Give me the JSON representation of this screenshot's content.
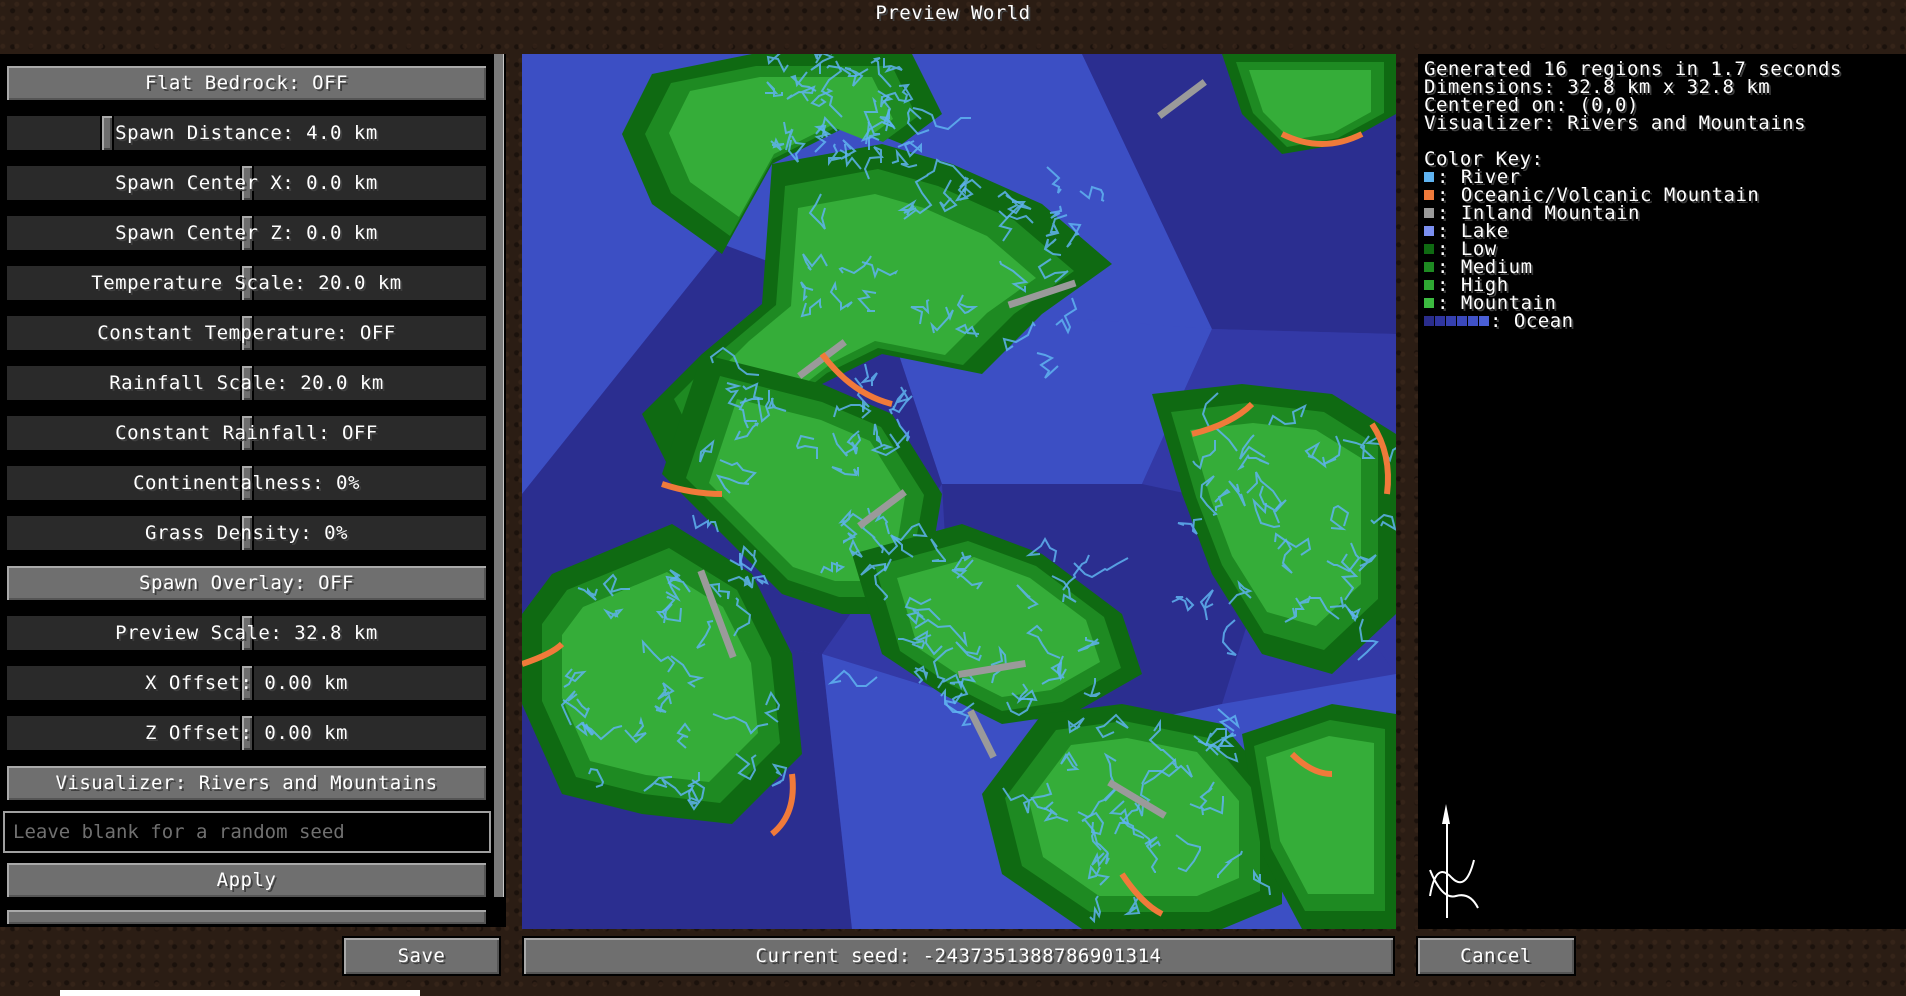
{
  "title": "Preview World",
  "settings": [
    {
      "kind": "button",
      "label": "Flat Bedrock: OFF"
    },
    {
      "kind": "slider",
      "label": "Spawn Distance: 4.0 km",
      "value": 0.2
    },
    {
      "kind": "slider",
      "label": "Spawn Center X: 0.0 km",
      "value": 0.5
    },
    {
      "kind": "slider",
      "label": "Spawn Center Z: 0.0 km",
      "value": 0.5
    },
    {
      "kind": "slider",
      "label": "Temperature Scale: 20.0 km",
      "value": 0.5
    },
    {
      "kind": "slider",
      "label": "Constant Temperature: OFF",
      "value": 0.5
    },
    {
      "kind": "slider",
      "label": "Rainfall Scale: 20.0 km",
      "value": 0.5
    },
    {
      "kind": "slider",
      "label": "Constant Rainfall: OFF",
      "value": 0.5
    },
    {
      "kind": "slider",
      "label": "Continentalness: 0%",
      "value": 0.5
    },
    {
      "kind": "slider",
      "label": "Grass Density: 0%",
      "value": 0.5
    },
    {
      "kind": "button",
      "label": "Spawn Overlay: OFF"
    },
    {
      "kind": "slider",
      "label": "Preview Scale: 32.8 km",
      "value": 0.5
    },
    {
      "kind": "slider",
      "label": "X Offset: 0.00 km",
      "value": 0.5
    },
    {
      "kind": "slider",
      "label": "Z Offset: 0.00 km",
      "value": 0.5
    },
    {
      "kind": "button",
      "label": "Visualizer: Rivers and Mountains"
    }
  ],
  "seed_input": {
    "placeholder": "Leave blank for a random seed",
    "value": ""
  },
  "apply_label": "Apply",
  "save_label": "Save",
  "current_seed": "Current seed: -2437351388786901314",
  "cancel_label": "Cancel",
  "info": {
    "lines": [
      "Generated 16 regions in 1.7 seconds",
      "Dimensions: 32.8 km x 32.8 km",
      "Centered on: (0,0)",
      "Visualizer: Rivers and Mountains"
    ],
    "color_key_title": "Color Key:",
    "key": [
      {
        "label": ": River",
        "color": "#5fb3f0"
      },
      {
        "label": ": Oceanic/Volcanic Mountain",
        "color": "#f07a3a"
      },
      {
        "label": ": Inland Mountain",
        "color": "#9a9a9a"
      },
      {
        "label": ": Lake",
        "color": "#7b8ff0"
      },
      {
        "label": ": Low",
        "color": "#0f6a12"
      },
      {
        "label": ": Medium",
        "color": "#1e8a22"
      },
      {
        "label": ": High",
        "color": "#2ea832"
      },
      {
        "label": ": Mountain",
        "color": "#3cba40"
      }
    ],
    "ocean_label": ": Ocean",
    "ocean_colors": [
      "#2a2d8c",
      "#2f35a0",
      "#3540b0",
      "#3a48bc",
      "#4052c8",
      "#4a5fd6"
    ]
  },
  "compass_icon": "north-compass-icon",
  "map_colors": {
    "ocean_deep": "#2b2e90",
    "ocean_mid": "#3339a6",
    "ocean_shallow": "#3c4fc4",
    "low": "#0f6a12",
    "medium": "#1e8a22",
    "high": "#35ad39",
    "river": "#5fb3f0",
    "mountain_inland": "#9a9a9a",
    "mountain_oceanic": "#f07a3a"
  }
}
